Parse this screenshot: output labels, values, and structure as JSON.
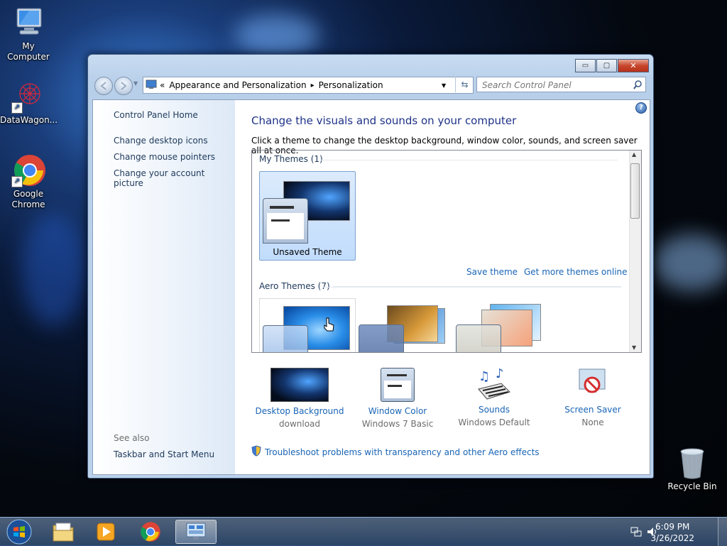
{
  "desktop": {
    "icons": [
      {
        "label": "My Computer",
        "icon": "computer-icon"
      },
      {
        "label": "DataWagon...",
        "icon": "datawagon-icon"
      },
      {
        "label": "Google Chrome",
        "icon": "chrome-icon"
      },
      {
        "label": "Recycle Bin",
        "icon": "recycle-bin-icon"
      }
    ]
  },
  "window": {
    "title_buttons": {
      "minimize": "▭",
      "maximize": "▢",
      "close": "✕"
    },
    "breadcrumb": {
      "prefix": "«",
      "items": [
        "Appearance and Personalization",
        "Personalization"
      ],
      "separator": "▸"
    },
    "search": {
      "placeholder": "Search Control Panel"
    },
    "left_pane": {
      "home": "Control Panel Home",
      "links": [
        "Change desktop icons",
        "Change mouse pointers",
        "Change your account picture"
      ],
      "see_also_label": "See also",
      "see_also_links": [
        "Taskbar and Start Menu"
      ]
    },
    "main": {
      "heading": "Change the visuals and sounds on your computer",
      "subheading": "Click a theme to change the desktop background, window color, sounds, and screen saver all at once.",
      "groups": [
        {
          "label": "My Themes (1)",
          "themes": [
            {
              "name": "Unsaved Theme",
              "selected": true
            }
          ]
        },
        {
          "label": "Aero Themes (7)"
        }
      ],
      "save_theme": "Save theme",
      "get_more": "Get more themes online",
      "bottom_items": [
        {
          "label": "Desktop Background",
          "sub": "download"
        },
        {
          "label": "Window Color",
          "sub": "Windows 7 Basic"
        },
        {
          "label": "Sounds",
          "sub": "Windows Default"
        },
        {
          "label": "Screen Saver",
          "sub": "None"
        }
      ],
      "troubleshoot": "Troubleshoot problems with transparency and other Aero effects"
    }
  },
  "taskbar": {
    "apps": [
      "start-orb",
      "explorer",
      "media-player",
      "chrome",
      "control-panel"
    ],
    "time": "6:09 PM",
    "date": "3/26/2022"
  },
  "colors": {
    "link": "#1964b5",
    "heading": "#1e3287",
    "nav_text": "#1e395b"
  }
}
